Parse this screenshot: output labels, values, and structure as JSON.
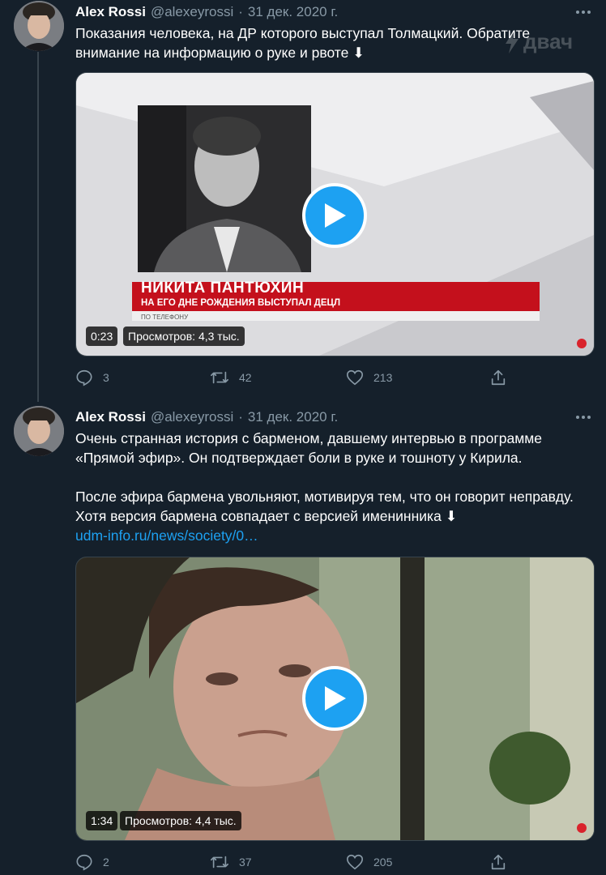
{
  "tweets": [
    {
      "author": "Alex Rossi",
      "handle": "@alexeyrossi",
      "separator": "·",
      "date": "31 дек. 2020 г.",
      "text_paragraphs": [
        "Показания человека, на ДР которого выступал Толмацкий. Обратите внимание на информацию о руке и рвоте ⬇"
      ],
      "media": {
        "duration": "0:23",
        "views": "Просмотров: 4,3 тыс.",
        "caption_name": "НИКИТА ПАНТЮХИН",
        "caption_sub": "НА ЕГО ДНЕ РОЖДЕНИЯ ВЫСТУПАЛ ДЕЦЛ",
        "caption_note": "ПО ТЕЛЕФОНУ"
      },
      "actions": {
        "replies": "3",
        "retweets": "42",
        "likes": "213"
      }
    },
    {
      "author": "Alex Rossi",
      "handle": "@alexeyrossi",
      "separator": "·",
      "date": "31 дек. 2020 г.",
      "text_paragraphs": [
        "Очень странная история с барменом, давшему интервью в программе «Прямой эфир». Он подтверждает боли в руке и тошноту у Кирила.",
        "После эфира бармена увольняют, мотивируя тем, что он говорит неправду. Хотя версия бармена совпадает с версией именинника ⬇"
      ],
      "link": "udm-info.ru/news/society/0…",
      "media": {
        "duration": "1:34",
        "views": "Просмотров: 4,4 тыс."
      },
      "actions": {
        "replies": "2",
        "retweets": "37",
        "likes": "205"
      }
    }
  ],
  "watermark": "двач",
  "colors": {
    "background": "#15202b",
    "secondary_text": "#8899a6",
    "accent": "#1da1f2",
    "border": "#38444d",
    "caption_red": "#c4101c"
  },
  "icons": [
    "more-icon",
    "reply-icon",
    "retweet-icon",
    "like-icon",
    "share-icon",
    "play-icon"
  ]
}
